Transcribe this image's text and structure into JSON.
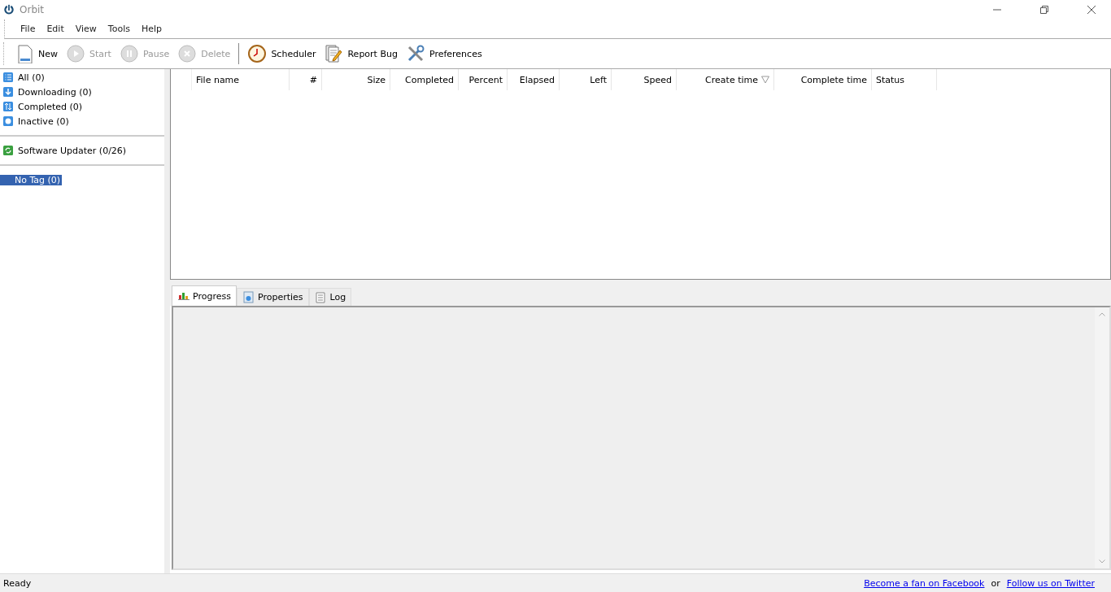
{
  "window": {
    "title": "Orbit"
  },
  "menu": [
    "File",
    "Edit",
    "View",
    "Tools",
    "Help"
  ],
  "toolbar": [
    {
      "label": "New",
      "kind": "new",
      "disabled": false
    },
    {
      "label": "Start",
      "kind": "start",
      "disabled": true
    },
    {
      "label": "Pause",
      "kind": "pause",
      "disabled": true
    },
    {
      "label": "Delete",
      "kind": "delete",
      "disabled": true
    },
    {
      "label": "Scheduler",
      "kind": "scheduler",
      "disabled": false
    },
    {
      "label": "Report Bug",
      "kind": "report",
      "disabled": false
    },
    {
      "label": "Preferences",
      "kind": "preferences",
      "disabled": false
    }
  ],
  "sidebar": {
    "groups": [
      [
        {
          "label": "All (0)",
          "kind": "all",
          "selected": false
        },
        {
          "label": "Downloading (0)",
          "kind": "downloading",
          "selected": false
        },
        {
          "label": "Completed (0)",
          "kind": "completed",
          "selected": false
        },
        {
          "label": "Inactive (0)",
          "kind": "inactive",
          "selected": false
        }
      ],
      [
        {
          "label": "Software Updater (0/26)",
          "kind": "updater",
          "selected": false
        }
      ],
      [
        {
          "label": "No Tag (0)",
          "kind": "tag",
          "selected": true
        }
      ]
    ]
  },
  "table": {
    "columns": [
      {
        "label": "File name",
        "sorted": false
      },
      {
        "label": "#",
        "sorted": false
      },
      {
        "label": "Size",
        "sorted": false
      },
      {
        "label": "Completed",
        "sorted": false
      },
      {
        "label": "Percent",
        "sorted": false
      },
      {
        "label": "Elapsed",
        "sorted": false
      },
      {
        "label": "Left",
        "sorted": false
      },
      {
        "label": "Speed",
        "sorted": false
      },
      {
        "label": "Create time",
        "sorted": true
      },
      {
        "label": "Complete time",
        "sorted": false
      },
      {
        "label": "Status",
        "sorted": false
      }
    ]
  },
  "tabs": [
    {
      "label": "Progress",
      "kind": "progress",
      "selected": true
    },
    {
      "label": "Properties",
      "kind": "properties",
      "selected": false
    },
    {
      "label": "Log",
      "kind": "log",
      "selected": false
    }
  ],
  "status_bar": {
    "text": "Ready",
    "links": [
      "Become a fan on Facebook",
      "Follow us on Twitter"
    ],
    "separator": "or"
  }
}
